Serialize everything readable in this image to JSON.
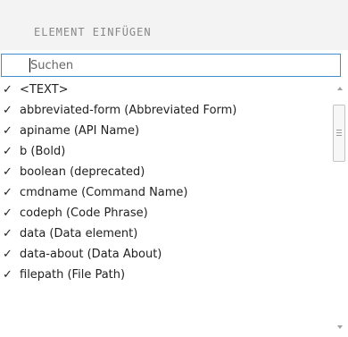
{
  "header": {
    "title": "ELEMENT EINFÜGEN"
  },
  "search": {
    "placeholder": "Suchen",
    "value": ""
  },
  "list": {
    "items": [
      {
        "label": "<TEXT>",
        "checked": true
      },
      {
        "label": "abbreviated-form (Abbreviated Form)",
        "checked": true
      },
      {
        "label": "apiname (API Name)",
        "checked": true
      },
      {
        "label": "b (Bold)",
        "checked": true
      },
      {
        "label": "boolean (deprecated)",
        "checked": true
      },
      {
        "label": "cmdname (Command Name)",
        "checked": true
      },
      {
        "label": "codeph (Code Phrase)",
        "checked": true
      },
      {
        "label": "data (Data element)",
        "checked": true
      },
      {
        "label": "data-about (Data About)",
        "checked": true
      },
      {
        "label": "filepath (File Path)",
        "checked": true
      }
    ],
    "check_glyph": "✓"
  },
  "icons": {
    "check": "check-icon",
    "scroll_up": "scroll-up-arrow-icon",
    "scroll_down": "scroll-down-arrow-icon",
    "grip": "scroll-grip-icon"
  },
  "colors": {
    "accent_border": "#3e8ed0",
    "header_bg": "#f3f3f3",
    "header_text": "#888888"
  }
}
